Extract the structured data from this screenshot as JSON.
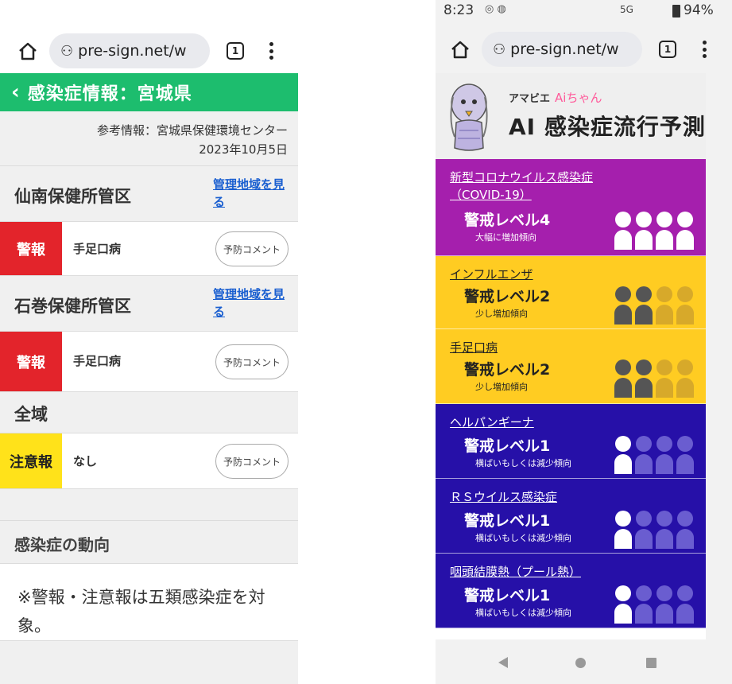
{
  "left": {
    "browser": {
      "url": "pre-sign.net/w",
      "tabs": "1"
    },
    "header": {
      "back_icon": "‹",
      "title": "感染症情報：宮城県"
    },
    "source": {
      "label": "参考情報：宮城県保健環境センター",
      "date": "2023年10月5日"
    },
    "districts": [
      {
        "name": "仙南保健所管区",
        "link": "管理地域を見る",
        "alert": {
          "level": "警報",
          "color": "#e3242b",
          "disease": "手足口病",
          "button": "予防コメント"
        }
      },
      {
        "name": "石巻保健所管区",
        "link": "管理地域を見る",
        "alert": {
          "level": "警報",
          "color": "#e3242b",
          "disease": "手足口病",
          "button": "予防コメント"
        }
      }
    ],
    "all_area": {
      "name": "全域",
      "alert": {
        "level": "注意報",
        "color": "#ffe21a",
        "disease": "なし",
        "button": "予防コメント"
      }
    },
    "trend_heading": "感染症の動向",
    "note": "※警報・注意報は五類感染症を対象。"
  },
  "right": {
    "status": {
      "time": "8:23",
      "network": "5G",
      "battery": "94%"
    },
    "browser": {
      "url": "pre-sign.net/w",
      "tabs": "1"
    },
    "app": {
      "mascot_name": "アマビエ",
      "ai_name": "Aiちゃん",
      "title": "AI 感染症流行予測"
    },
    "cards": [
      {
        "name": "新型コロナウイルス感染症（COVID-19）",
        "level_text": "警戒レベル4",
        "level": 4,
        "trend": "大幅に増加傾向",
        "bg": "#a51fad",
        "text_color": "#ffffff",
        "on_color": "#ffffff",
        "off_color": "#c76fcb"
      },
      {
        "name": "インフルエンザ",
        "level_text": "警戒レベル2",
        "level": 2,
        "trend": "少し増加傾向",
        "bg": "#ffcc22",
        "text_color": "#222222",
        "on_color": "#555555",
        "off_color": "#d7a92a"
      },
      {
        "name": "手足口病",
        "level_text": "警戒レベル2",
        "level": 2,
        "trend": "少し増加傾向",
        "bg": "#ffcc22",
        "text_color": "#222222",
        "on_color": "#555555",
        "off_color": "#d7a92a"
      },
      {
        "name": "ヘルパンギーナ",
        "level_text": "警戒レベル1",
        "level": 1,
        "trend": "横ばいもしくは減少傾向",
        "bg": "#2610a8",
        "text_color": "#ffffff",
        "on_color": "#ffffff",
        "off_color": "#6a5dd0"
      },
      {
        "name": "ＲＳウイルス感染症",
        "level_text": "警戒レベル1",
        "level": 1,
        "trend": "横ばいもしくは減少傾向",
        "bg": "#2610a8",
        "text_color": "#ffffff",
        "on_color": "#ffffff",
        "off_color": "#6a5dd0"
      },
      {
        "name": "咽頭結膜熱（プール熱）",
        "level_text": "警戒レベル1",
        "level": 1,
        "trend": "横ばいもしくは減少傾向",
        "bg": "#2610a8",
        "text_color": "#ffffff",
        "on_color": "#ffffff",
        "off_color": "#6a5dd0"
      }
    ]
  }
}
